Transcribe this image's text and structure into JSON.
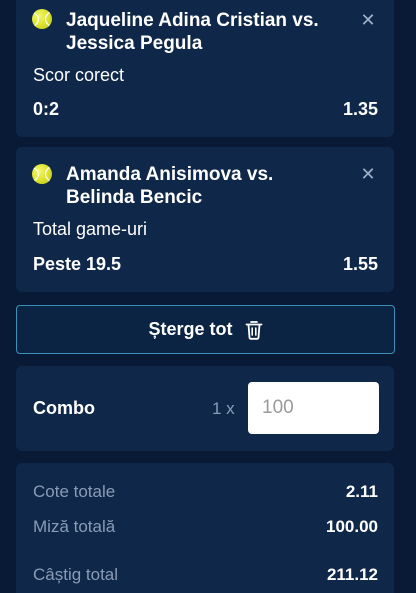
{
  "bets": [
    {
      "title": "Jaqueline Adina Cristian vs. Jessica Pegula",
      "market": "Scor corect",
      "selection": "0:2",
      "odds": "1.35",
      "icon": "tennis-ball-icon",
      "close_icon": "close-icon"
    },
    {
      "title": "Amanda Anisimova vs. Belinda Bencic",
      "market": "Total game-uri",
      "selection": "Peste 19.5",
      "odds": "1.55",
      "icon": "tennis-ball-icon",
      "close_icon": "close-icon"
    }
  ],
  "clear_button": {
    "label": "Șterge tot",
    "icon": "trash-icon"
  },
  "combo": {
    "label": "Combo",
    "multiplier": "1 x",
    "stake_placeholder": "100"
  },
  "summary": {
    "total_odds_label": "Cote totale",
    "total_odds_value": "2.11",
    "total_stake_label": "Miză totală",
    "total_stake_value": "100.00",
    "total_win_label": "Câștig total",
    "total_win_value": "211.12"
  },
  "colors": {
    "background": "#081a35",
    "card": "#0f2849",
    "accent_border": "#3b8fb8",
    "muted_text": "#8a9bb6",
    "ball": "#d9e02a"
  }
}
